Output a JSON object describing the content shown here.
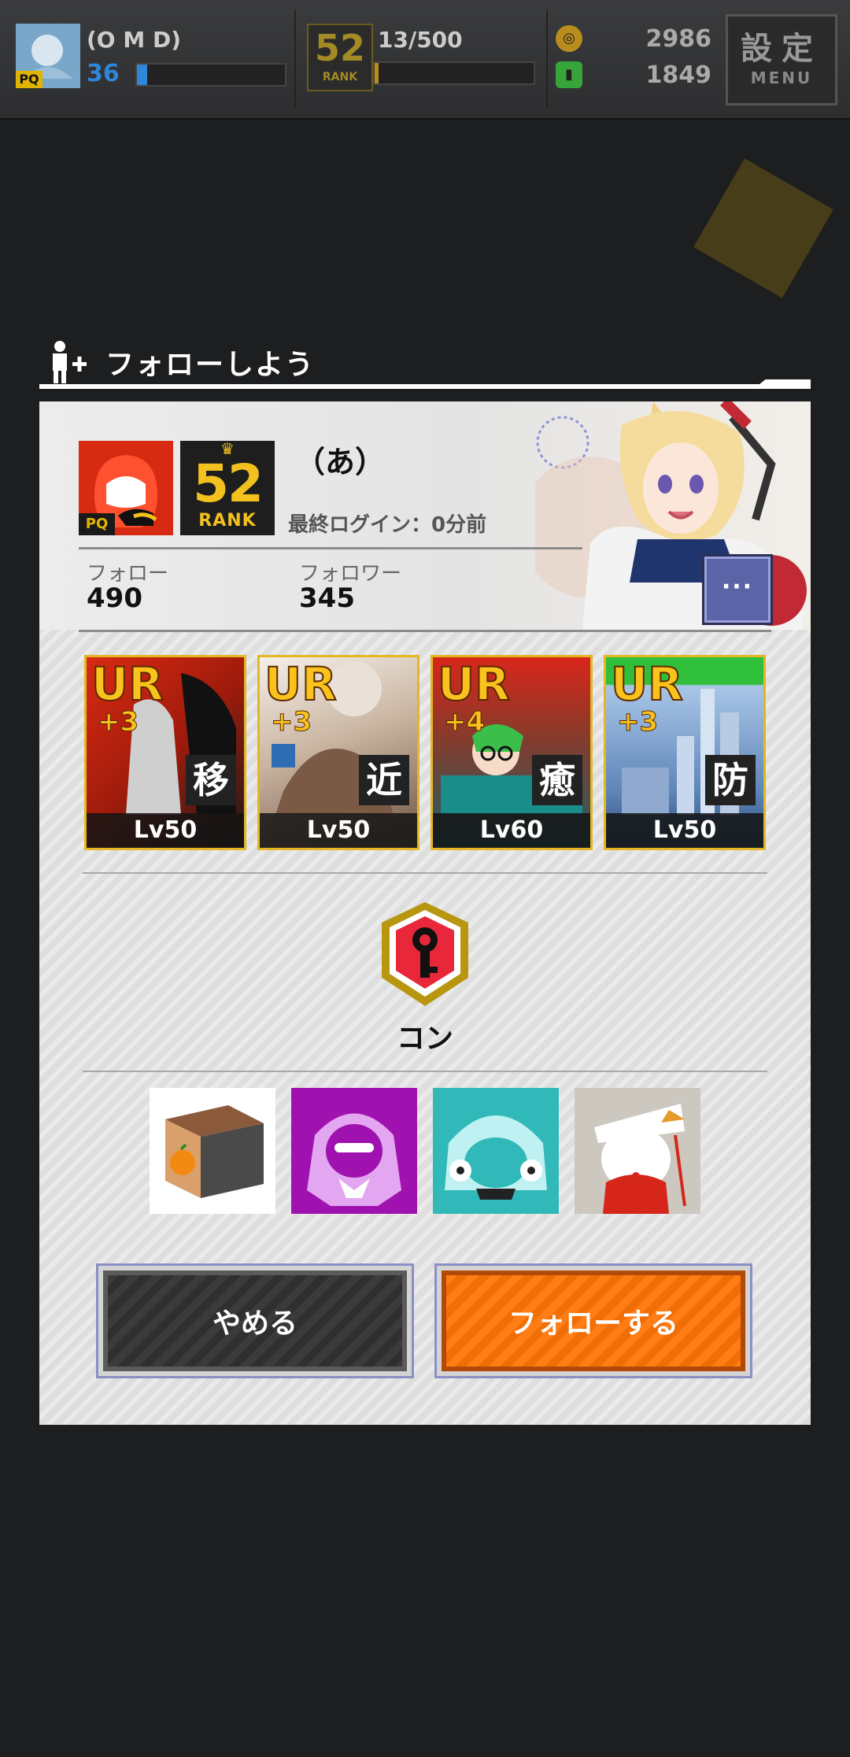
{
  "topbar": {
    "player_name": "(O M D)",
    "player_level": "36",
    "player_xp_fraction": 0.07,
    "rank_number": "52",
    "rank_label": "RANK",
    "stamina": "13/500",
    "stamina_fraction": 0.026,
    "coins": "2986",
    "gems": "1849",
    "menu_kanji": "設定",
    "menu_label": "MENU",
    "pq_badge": "PQ"
  },
  "dialog": {
    "title": "フォローしよう",
    "user": {
      "name": "（あ）",
      "rank_number": "52",
      "rank_label": "RANK",
      "pq_badge": "PQ",
      "last_login": "最終ログイン：0分前",
      "follow_label": "フォロー",
      "follow_count": "490",
      "follower_label": "フォロワー",
      "follower_count": "345",
      "more_label": "···"
    },
    "deck": [
      {
        "rarity": "UR",
        "plus": "+3",
        "role": "移",
        "level": "Lv50"
      },
      {
        "rarity": "UR",
        "plus": "+3",
        "role": "近",
        "level": "Lv50"
      },
      {
        "rarity": "UR",
        "plus": "+4",
        "role": "癒",
        "level": "Lv60"
      },
      {
        "rarity": "UR",
        "plus": "+3",
        "role": "防",
        "level": "Lv50"
      }
    ],
    "title_badge": {
      "name": "コン",
      "icon": "key-emblem-icon"
    },
    "stamps": [
      "orange-box-icon",
      "purple-character-icon",
      "teal-character-icon",
      "white-hair-character-icon"
    ],
    "cancel_label": "やめる",
    "follow_button_label": "フォローする"
  },
  "colors": {
    "accent_orange": "#ff7d14",
    "rank_gold": "#f3c11e",
    "xp_blue": "#2f86d8"
  }
}
